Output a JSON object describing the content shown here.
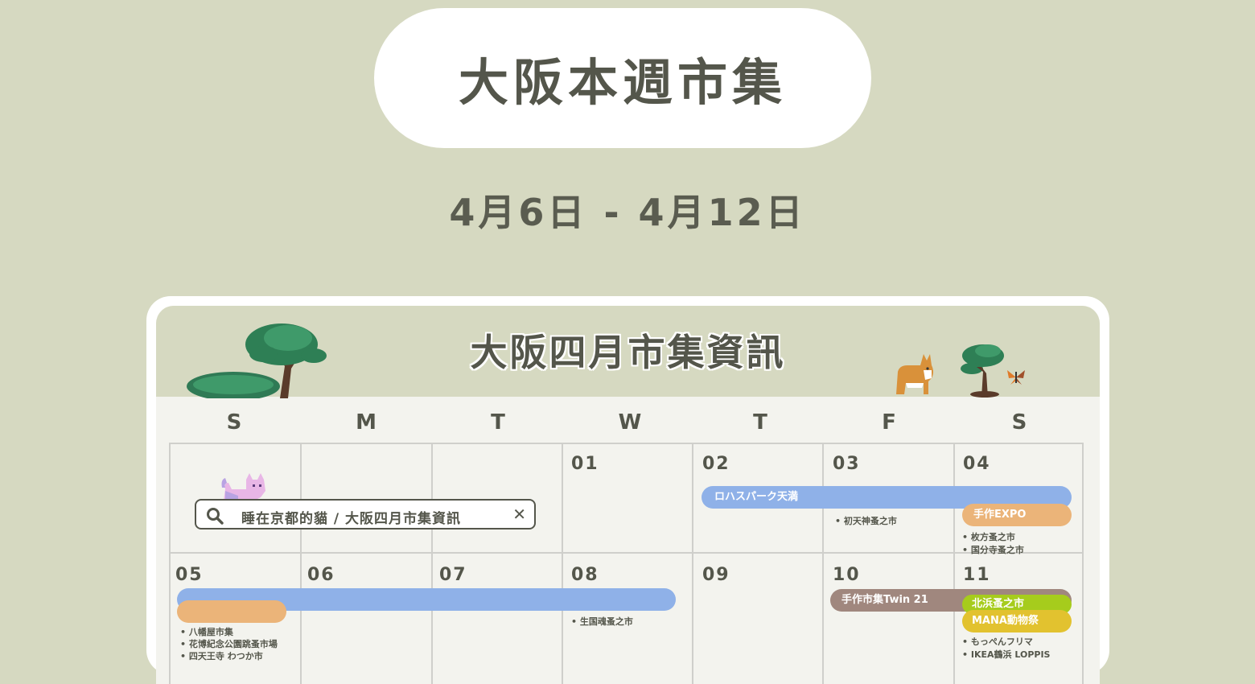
{
  "header": {
    "title": "大阪本週市集",
    "date_range": "4月6日 - 4月12日"
  },
  "calendar": {
    "banner_title": "大阪四月市集資訊",
    "weekdays": [
      "S",
      "M",
      "T",
      "W",
      "T",
      "F",
      "S"
    ],
    "week1": {
      "days": [
        "01",
        "02",
        "03",
        "04"
      ]
    },
    "week2": {
      "days": [
        "05",
        "06",
        "07",
        "08",
        "09",
        "10",
        "11"
      ]
    },
    "search": {
      "text": "睡在京都的貓 / 大阪四月市集資訊",
      "close": "✕"
    },
    "events": {
      "lohas": "ロハスパーク天満",
      "expo": "手作EXPO",
      "twin21": "手作市集Twin 21",
      "kitahama": "北浜蚤之市",
      "mana": "MANA動物祭",
      "blue_week2": "",
      "orange_week2": ""
    },
    "notes": {
      "hatsutenjin": "初天神蚤之市",
      "hirakata": "枚方蚤之市",
      "kokubunji": "国分寺蚤之市",
      "ikutama": "生国魂蚤之市",
      "hachiman": "八幡屋市集",
      "hanahaku": "花博紀念公園跳蚤市場",
      "shitennoji": "四天王寺 わつか市",
      "moppen": "もっぺんフリマ",
      "ikea": "IKEA鶴浜 LOPPIS"
    },
    "colors": {
      "blue": "#8fb1e8",
      "orange": "#ebb479",
      "taupe": "#a0877e",
      "green": "#a6cc1c",
      "yellow": "#e2c22f"
    }
  }
}
